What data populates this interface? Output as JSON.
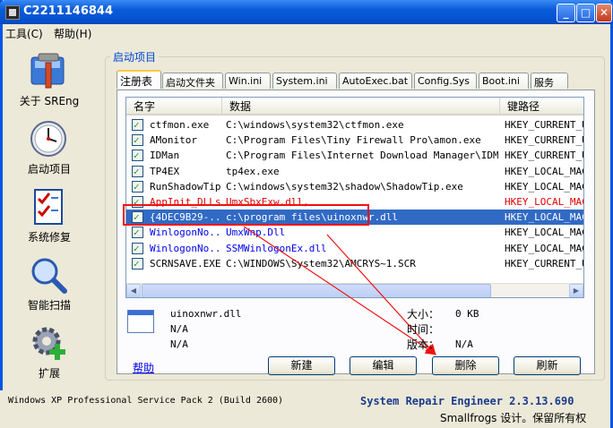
{
  "window": {
    "title": "C2211146844"
  },
  "menu": [
    {
      "label": "工具(C)"
    },
    {
      "label": "帮助(H)"
    }
  ],
  "sidebar": [
    {
      "label": "关于 SREng",
      "icon": "tools-icon"
    },
    {
      "label": "启动项目",
      "icon": "clock-icon"
    },
    {
      "label": "系统修复",
      "icon": "checklist-icon"
    },
    {
      "label": "智能扫描",
      "icon": "magnifier-icon"
    },
    {
      "label": "扩展",
      "icon": "gear-plus-icon"
    }
  ],
  "group_title": "启动项目",
  "tabs": [
    {
      "label": "注册表"
    },
    {
      "label": "启动文件夹"
    },
    {
      "label": "Win.ini"
    },
    {
      "label": "System.ini"
    },
    {
      "label": "AutoExec.bat"
    },
    {
      "label": "Config.Sys"
    },
    {
      "label": "Boot.ini"
    },
    {
      "label": "服务"
    }
  ],
  "columns": [
    "名字",
    "数据",
    "键路径"
  ],
  "rows": [
    {
      "name": "ctfmon.exe",
      "data": "C:\\windows\\system32\\ctfmon.exe",
      "path": "HKEY_CURRENT_USER",
      "style": ""
    },
    {
      "name": "AMonitor",
      "data": "C:\\Program Files\\Tiny Firewall Pro\\amon.exe",
      "path": "HKEY_CURRENT_USER",
      "style": ""
    },
    {
      "name": "IDMan",
      "data": "C:\\Program Files\\Internet Download Manager\\IDM...",
      "path": "HKEY_CURRENT_USER",
      "style": ""
    },
    {
      "name": "TP4EX",
      "data": "tp4ex.exe",
      "path": "HKEY_LOCAL_MACHINE",
      "style": ""
    },
    {
      "name": "RunShadowTip",
      "data": "C:\\windows\\system32\\shadow\\ShadowTip.exe",
      "path": "HKEY_LOCAL_MACHINE",
      "style": ""
    },
    {
      "name": "AppInit_DLLs",
      "data": "UmxSbxExw.dll,",
      "path": "HKEY_LOCAL_MACHINE",
      "style": "red"
    },
    {
      "name": "{4DEC9B29-...",
      "data": "c:\\program files\\uinoxnwr.dll",
      "path": "HKEY_LOCAL_MACHINE",
      "style": "sel"
    },
    {
      "name": "WinlogonNo...",
      "data": "UmxWnp.Dll",
      "path": "HKEY_LOCAL_MACHINE",
      "style": "blue"
    },
    {
      "name": "WinlogonNo...",
      "data": "SSMWinlogonEx.dll",
      "path": "HKEY_LOCAL_MACHINE",
      "style": "blue"
    },
    {
      "name": "SCRNSAVE.EXE",
      "data": "C:\\WINDOWS\\System32\\AMCRYS~1.SCR",
      "path": "HKEY_CURRENT_USER",
      "style": ""
    }
  ],
  "details": {
    "filename": "uinoxnwr.dll",
    "company": "N/A",
    "description": "N/A",
    "size_label": "大小：",
    "size_value": "0 KB",
    "time_label": "时间：",
    "time_value": "",
    "version_label": "版本：",
    "version_value": "N/A"
  },
  "buttons": {
    "help": "帮助",
    "new": "新建",
    "edit": "编辑",
    "delete": "删除",
    "refresh": "刷新"
  },
  "status": {
    "os": "Windows XP Professional Service Pack 2 (Build 2600)",
    "product": "System Repair Engineer 2.3.13.690",
    "copyright": "Smallfrogs 设计。保留所有权利。"
  },
  "colors": {
    "title_blue": "#0055e5",
    "selection": "#316ac5",
    "highlight_red": "#e11111",
    "link_blue": "#0000ee"
  }
}
